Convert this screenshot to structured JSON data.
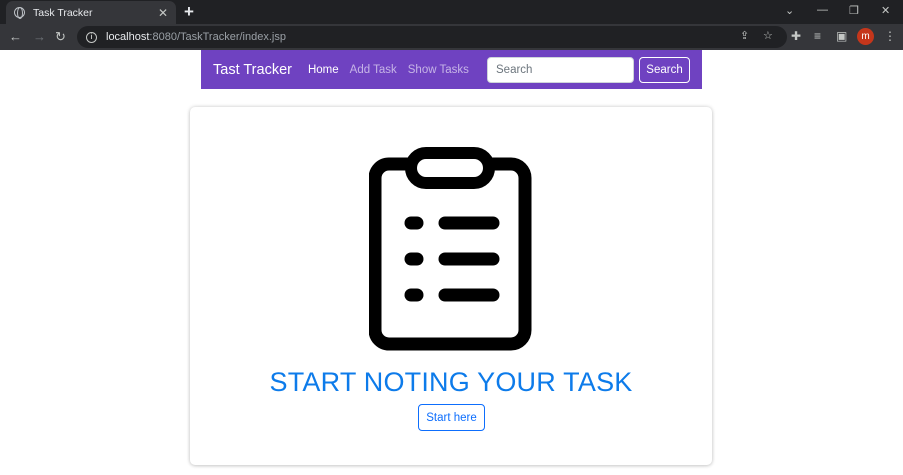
{
  "browser": {
    "tab_title": "Task Tracker",
    "tab_close": "✕",
    "new_tab": "+",
    "url_host": "localhost",
    "url_rest": ":8080/TaskTracker/index.jsp",
    "profile_initial": "m",
    "icons": [
      "back-icon",
      "forward-icon",
      "reload-icon",
      "info-icon",
      "share-icon",
      "bookmark-star-icon",
      "extensions-icon",
      "media-icon",
      "side-panel-icon",
      "menu-icon"
    ],
    "profile_color": "#c5361b"
  },
  "navbar": {
    "brand": "Tast Tracker",
    "links": [
      "Home",
      "Add Task",
      "Show Tasks"
    ],
    "search_placeholder": "Search",
    "search_button": "Search",
    "background_color": "#6f42c1"
  },
  "hero": {
    "icon": "clipboard-list-icon",
    "title": "START NOTING YOUR TASK",
    "button": "Start here",
    "title_color": "#0d7bea"
  }
}
